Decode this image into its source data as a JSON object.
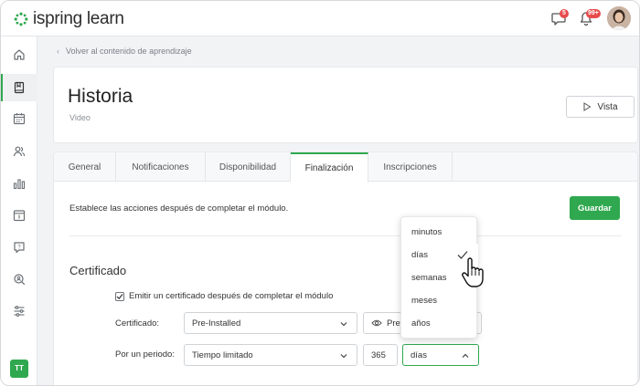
{
  "app": {
    "logo_brand": "ispring",
    "logo_product": "learn"
  },
  "topbar": {
    "notifications_badge": "5",
    "alerts_badge": "99+"
  },
  "sidebar": {
    "items": [
      "home",
      "courses",
      "calendar",
      "users",
      "reports",
      "content",
      "help",
      "search",
      "settings"
    ],
    "active_index": 1,
    "user_initials": "TT"
  },
  "breadcrumb": {
    "back_label": "Volver al contenido de aprendizaje"
  },
  "header": {
    "title": "Historia",
    "subtitle": "Video",
    "preview_button": "Vista"
  },
  "tabs": [
    {
      "label": "General",
      "active": false
    },
    {
      "label": "Notificaciones",
      "active": false
    },
    {
      "label": "Disponibilidad",
      "active": false
    },
    {
      "label": "Finalización",
      "active": true
    },
    {
      "label": "Inscripciones",
      "active": false
    }
  ],
  "completion": {
    "intro_text": "Establece las acciones después de completar el módulo.",
    "save_button": "Guardar",
    "section_title": "Certificado",
    "emit_certificate_label": "Emitir un certificado después de completar el módulo",
    "emit_certificate_checked": true,
    "certificate_label": "Certificado:",
    "certificate_value": "Pre-Installed",
    "preview_partial": "Prev",
    "period_label": "Por un periodo:",
    "period_type_value": "Tiempo limitado",
    "period_amount": "365",
    "period_unit_value": "días"
  },
  "unit_dropdown": {
    "options": [
      "minutos",
      "días",
      "semanas",
      "meses",
      "años"
    ],
    "selected_index": 1
  },
  "colors": {
    "accent": "#2fa84f",
    "badge": "#e84b4b"
  }
}
